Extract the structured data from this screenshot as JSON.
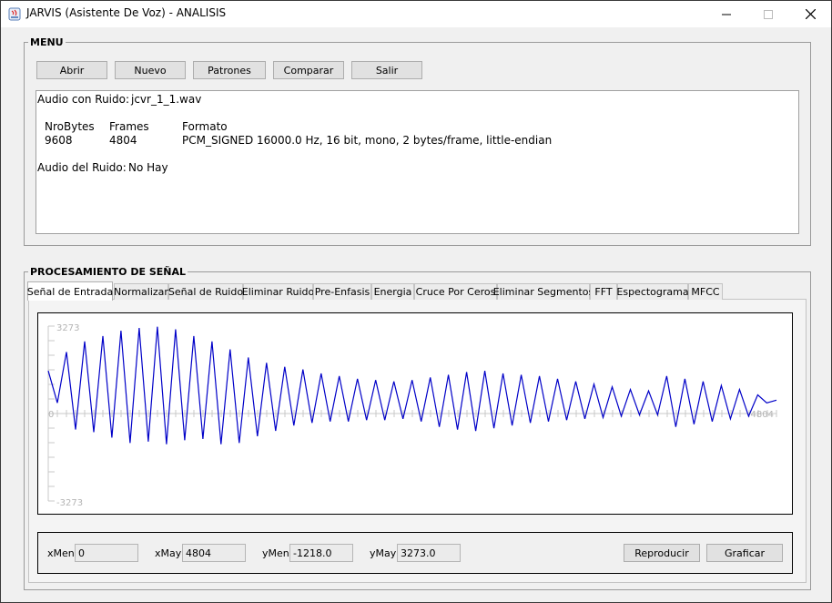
{
  "window": {
    "title": "JARVIS (Asistente De Voz) - ANALISIS"
  },
  "menu": {
    "title": "MENU",
    "buttons": [
      "Abrir",
      "Nuevo",
      "Patrones",
      "Comparar",
      "Salir"
    ]
  },
  "info": {
    "audio_con_ruido_label": "Audio con Ruido:",
    "audio_con_ruido_value": "jcvr_1_1.wav",
    "headers": {
      "bytes": "NroBytes",
      "frames": "Frames",
      "formato": "Formato"
    },
    "values": {
      "bytes": "9608",
      "frames": "4804",
      "formato": "PCM_SIGNED 16000.0 Hz, 16 bit, mono, 2 bytes/frame, little-endian"
    },
    "audio_del_ruido_label": "Audio del Ruido:",
    "audio_del_ruido_value": "No Hay"
  },
  "signal": {
    "title": "PROCESAMIENTO DE SEÑAL",
    "tabs": [
      "Señal de Entrada",
      "Normalizar",
      "Señal de Ruido",
      "Eliminar Ruido",
      "Pre-Enfasis",
      "Energia",
      "Cruce Por Ceros",
      "Eliminar Segmentos",
      "FFT",
      "Espectograma",
      "MFCC"
    ],
    "active_tab": 0
  },
  "chart_data": {
    "type": "line",
    "title": "",
    "xlabel": "",
    "ylabel": "",
    "y_max_label": "3273",
    "y_min_label": "-3273",
    "x_origin_label": "0",
    "x_max_label": "4804",
    "xlim": [
      0,
      4804
    ],
    "ylim": [
      -3273,
      3273
    ],
    "series_color": "#0000c8",
    "series": [
      {
        "x": [
          0,
          60,
          120,
          180,
          240,
          300,
          360,
          420,
          480,
          540,
          600,
          660,
          720,
          780,
          840,
          900,
          960,
          1020,
          1080,
          1140,
          1200,
          1260,
          1320,
          1380,
          1440,
          1500,
          1560,
          1620,
          1680,
          1740,
          1800,
          1860,
          1920,
          1980,
          2040,
          2100,
          2160,
          2220,
          2280,
          2340,
          2400,
          2460,
          2520,
          2580,
          2640,
          2700,
          2760,
          2820,
          2880,
          2940,
          3000,
          3060,
          3120,
          3180,
          3240,
          3300,
          3360,
          3420,
          3480,
          3540,
          3600,
          3660,
          3720,
          3780,
          3840,
          3900,
          3960,
          4020,
          4080,
          4140,
          4200,
          4260,
          4320,
          4380,
          4440,
          4500,
          4560,
          4620,
          4680,
          4740,
          4804
        ],
        "values": [
          1600,
          400,
          2300,
          -600,
          2700,
          -700,
          2900,
          -900,
          3100,
          -1100,
          3200,
          -1050,
          3250,
          -1150,
          3150,
          -1000,
          2900,
          -950,
          2700,
          -1150,
          2400,
          -1100,
          2100,
          -850,
          1900,
          -650,
          1750,
          -450,
          1650,
          -350,
          1500,
          -300,
          1400,
          -300,
          1300,
          -250,
          1250,
          -250,
          1200,
          -200,
          1250,
          -300,
          1350,
          -500,
          1450,
          -600,
          1550,
          -650,
          1600,
          -550,
          1500,
          -450,
          1450,
          -350,
          1400,
          -300,
          1300,
          -250,
          1200,
          -200,
          1100,
          -150,
          1000,
          -100,
          900,
          -50,
          850,
          -50,
          1400,
          -500,
          1300,
          -400,
          1200,
          -300,
          1050,
          -200,
          900,
          -100,
          700,
          400,
          500
        ]
      }
    ],
    "grid": false
  },
  "controls": {
    "xmen_label": "xMen",
    "xmen_value": "0",
    "xmay_label": "xMay",
    "xmay_value": "4804",
    "ymen_label": "yMen",
    "ymen_value": "-1218.0",
    "ymay_label": "yMay",
    "ymay_value": "3273.0",
    "play_label": "Reproducir",
    "plot_label": "Graficar"
  }
}
